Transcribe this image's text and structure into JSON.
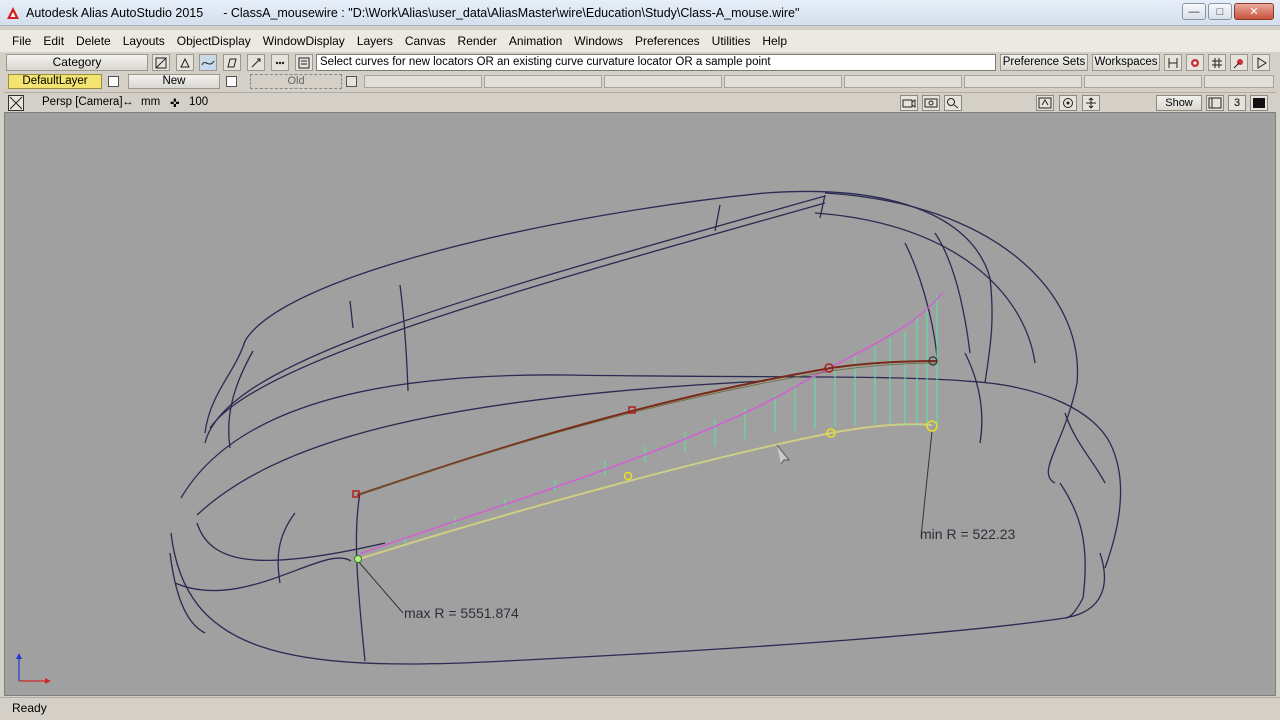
{
  "window": {
    "app_title": "Autodesk Alias AutoStudio 2015",
    "file_title": "- ClassA_mousewire : \"D:\\Work\\Alias\\user_data\\AliasMaster\\wire\\Education\\Study\\Class-A_mouse.wire\"",
    "controls": {
      "minimize": "—",
      "maximize": "□",
      "close": "✕"
    }
  },
  "menu": [
    "File",
    "Edit",
    "Delete",
    "Layouts",
    "ObjectDisplay",
    "WindowDisplay",
    "Layers",
    "Canvas",
    "Render",
    "Animation",
    "Windows",
    "Preferences",
    "Utilities",
    "Help"
  ],
  "toolbar": {
    "category_label": "Category",
    "prompt": "Select curves for new locators OR an existing curve curvature locator OR a sample point",
    "preference_sets": "Preference Sets",
    "workspaces": "Workspaces"
  },
  "layers": {
    "default": "DefaultLayer",
    "new": "New",
    "old": "Old"
  },
  "viewport": {
    "camera_label": "Persp [Camera]",
    "unit_label": "mm",
    "grid_value": "100",
    "show_button": "Show",
    "view_number": "3"
  },
  "annotations": {
    "max_radius": "max R = 5551.874",
    "min_radius": "min R = 522.23"
  },
  "colors": {
    "viewport_bg": "#a0a0a0",
    "wire": "#2a2a52",
    "curve_brown": "#7a2a18",
    "curve_green": "#6a6a3a",
    "comb": "#57e6a6",
    "envelope": "#d65bd6",
    "sample_curve": "#f0c070",
    "default_layer": "#f2e46e"
  },
  "status": {
    "text": "Ready"
  }
}
